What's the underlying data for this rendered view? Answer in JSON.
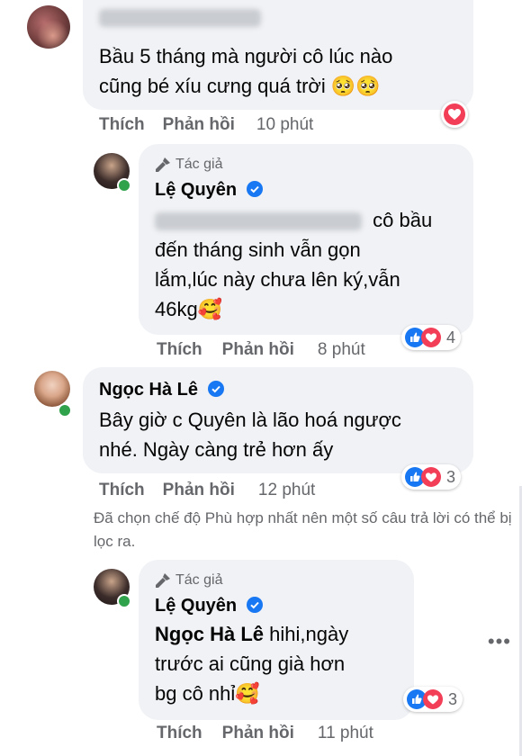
{
  "comments": [
    {
      "id": "c1",
      "author_blurred": "Phan Nguyệt Quỳnh",
      "text_line1": "Bầu 5 tháng mà người cô lúc nào",
      "text_line2": "cũng bé xíu cưng quá trời 🥺🥺",
      "like_label": "Thích",
      "reply_label": "Phản hồi",
      "time": "10 phút",
      "reaction": "love"
    },
    {
      "id": "r1",
      "author_tag": "Tác giả",
      "author": "Lệ Quyên",
      "mention_blurred": "Phan Nguyệt Quỳnh",
      "text_line1_tail": "cô bầu",
      "text_line2": "đến tháng sinh vẫn gọn",
      "text_line3": "lắm,lúc này chưa lên ký,vẫn",
      "text_line4": "46kg🥰",
      "like_label": "Thích",
      "reply_label": "Phản hồi",
      "time": "8 phút",
      "reaction_count": "4"
    },
    {
      "id": "c2",
      "author": "Ngọc Hà Lê",
      "text_line1": "Bây giờ c Quyên là lão hoá ngược",
      "text_line2": "nhé. Ngày càng trẻ hơn ấy",
      "like_label": "Thích",
      "reply_label": "Phản hồi",
      "time": "12 phút",
      "reaction_count": "3"
    },
    {
      "id": "r2",
      "author_tag": "Tác giả",
      "author": "Lệ Quyên",
      "mention": "Ngọc Hà Lê",
      "text_line1_tail": "hihi,ngày",
      "text_line2": "trước ai cũng già hơn",
      "text_line3": "bg cô nhỉ🥰",
      "like_label": "Thích",
      "reply_label": "Phản hồi",
      "time": "11 phút",
      "reaction_count": "3"
    }
  ],
  "filter_note": "Đã chọn chế độ Phù hợp nhất nên một số câu trả lời có thể bị lọc ra.",
  "more_icon": "•••",
  "colors": {
    "bubble": "#f0f2f5",
    "muted": "#65676b",
    "like_blue": "#1877f2",
    "love_red": "#f33e58",
    "online": "#31a24c"
  }
}
